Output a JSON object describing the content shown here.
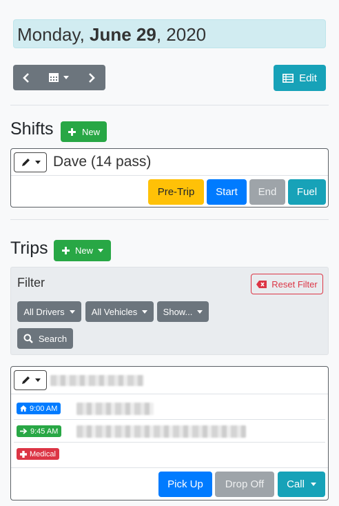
{
  "header": {
    "weekday": "Monday, ",
    "month_day": "June 29",
    "year": ", 2020"
  },
  "toolbar": {
    "edit_label": "Edit"
  },
  "shifts": {
    "title": "Shifts",
    "new_label": "New",
    "driver": "Dave (14 pass)",
    "buttons": {
      "pretrip": "Pre-Trip",
      "start": "Start",
      "end": "End",
      "fuel": "Fuel"
    }
  },
  "trips": {
    "title": "Trips",
    "new_label": "New",
    "filter": {
      "title": "Filter",
      "reset_label": "Reset Filter",
      "drivers": "All Drivers",
      "vehicles": "All Vehicles",
      "show": "Show...",
      "search": "Search"
    },
    "trip": {
      "pickup_time": "9:00 AM",
      "dropoff_time": "9:45 AM",
      "tag": "Medical",
      "buttons": {
        "pickup": "Pick Up",
        "dropoff": "Drop Off",
        "call": "Call"
      }
    }
  },
  "colors": {
    "info": "#17a2b8",
    "success": "#28a745",
    "warning": "#ffc107",
    "primary": "#007bff",
    "secondary": "#6c757d",
    "danger": "#dc3545"
  }
}
